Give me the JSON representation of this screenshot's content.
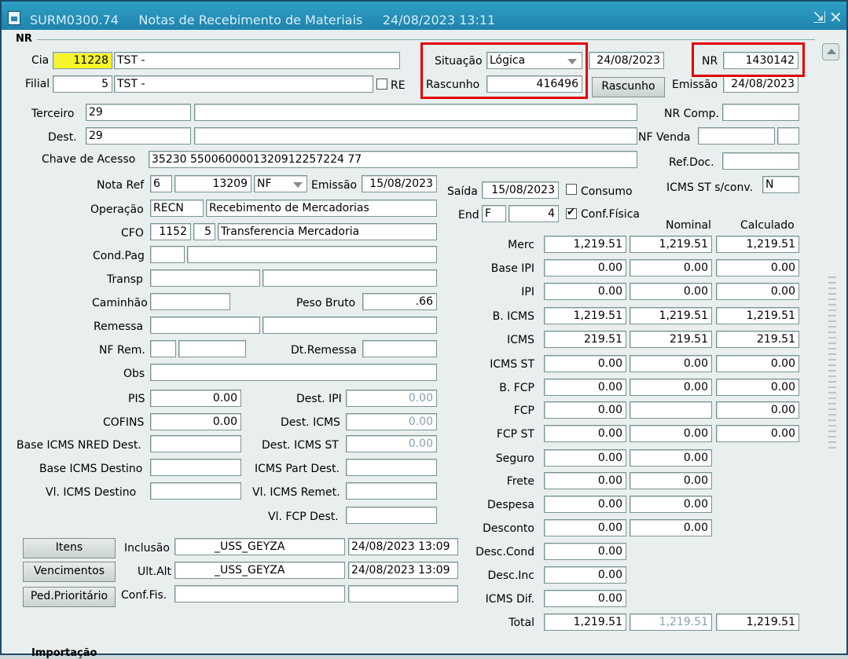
{
  "window": {
    "code": "SURM0300.74",
    "title": "Notas de Recebimento de Materiais",
    "datetime": "24/08/2023 13:11"
  },
  "section": {
    "nr_label": "NR",
    "importacao_label": "Importação"
  },
  "header": {
    "cia_label": "Cia",
    "cia_code": "11228",
    "cia_name": "TST -",
    "filial_label": "Filial",
    "filial_code": "5",
    "filial_name": "TST -",
    "re_label": "RE",
    "situacao_label": "Situação",
    "situacao_value": "Lógica",
    "situacao_date": "24/08/2023",
    "rascunho_label": "Rascunho",
    "rascunho_value": "416496",
    "rascunho_button": "Rascunho",
    "nr_label": "NR",
    "nr_value": "1430142",
    "emissao_label": "Emissão",
    "emissao_value": "24/08/2023"
  },
  "party": {
    "terceiro_label": "Terceiro",
    "terceiro_code": "29",
    "terceiro_name": "",
    "dest_label": "Dest.",
    "dest_code": "29",
    "dest_name": "",
    "chave_label": "Chave de Acesso",
    "chave_value": "35230 5500600001320912257224 77",
    "nrcomp_label": "NR Comp.",
    "nfvenda_label": "NF Venda",
    "refdoc_label": "Ref.Doc."
  },
  "nota": {
    "notaref_label": "Nota Ref",
    "notaref_serie": "6",
    "notaref_num": "13209",
    "notaref_tipo": "NF",
    "emissao_label": "Emissão",
    "emissao_value": "15/08/2023",
    "saida_label": "Saída",
    "saida_value": "15/08/2023",
    "consumo_label": "Consumo",
    "icmsst_label": "ICMS ST s/conv.",
    "icmsst_value": "N",
    "operacao_label": "Operação",
    "operacao_code": "RECN",
    "operacao_desc": "Recebimento de Mercadorias",
    "end_label": "End",
    "end_code": "F",
    "end_num": "4",
    "conffisica_label": "Conf.Física",
    "cfo_label": "CFO",
    "cfo_code": "1152",
    "cfo_sub": "5",
    "cfo_desc": "Transferencia Mercadoria",
    "condpag_label": "Cond.Pag",
    "transp_label": "Transp",
    "caminhao_label": "Caminhão",
    "pesobruto_label": "Peso Bruto",
    "pesobruto_value": ".66",
    "remessa_label": "Remessa",
    "nfrem_label": "NF Rem.",
    "dtremessa_label": "Dt.Remessa",
    "obs_label": "Obs"
  },
  "taxes": {
    "pis_label": "PIS",
    "pis_value": "0.00",
    "cofins_label": "COFINS",
    "cofins_value": "0.00",
    "baseicmsnred_label": "Base ICMS NRED Dest.",
    "baseicmsdest_label": "Base ICMS Destino",
    "vlicmsdest_label": "Vl. ICMS Destino",
    "destipi_label": "Dest. IPI",
    "destipi_value": "0.00",
    "desticms_label": "Dest. ICMS",
    "desticms_value": "0.00",
    "desticmsst_label": "Dest. ICMS ST",
    "desticmsst_value": "0.00",
    "icmspart_label": "ICMS Part Dest.",
    "vlicmsremet_label": "Vl. ICMS Remet.",
    "vlfcp_label": "Vl. FCP Dest."
  },
  "totals_headers": {
    "nominal": "Nominal",
    "calculado": "Calculado"
  },
  "totals": [
    {
      "label": "Merc",
      "v1": "1,219.51",
      "v2": "1,219.51",
      "v3": "1,219.51"
    },
    {
      "label": "Base IPI",
      "v1": "0.00",
      "v2": "0.00",
      "v3": "0.00"
    },
    {
      "label": "IPI",
      "v1": "0.00",
      "v2": "0.00",
      "v3": "0.00"
    },
    {
      "label": "B. ICMS",
      "v1": "1,219.51",
      "v2": "1,219.51",
      "v3": "1,219.51"
    },
    {
      "label": "ICMS",
      "v1": "219.51",
      "v2": "219.51",
      "v3": "219.51"
    },
    {
      "label": "ICMS ST",
      "v1": "0.00",
      "v2": "0.00",
      "v3": "0.00"
    },
    {
      "label": "B. FCP",
      "v1": "0.00",
      "v2": "0.00",
      "v3": "0.00"
    },
    {
      "label": "FCP",
      "v1": "0.00",
      "v2": "",
      "v3": "0.00"
    },
    {
      "label": "FCP ST",
      "v1": "0.00",
      "v2": "0.00",
      "v3": "0.00"
    },
    {
      "label": "Seguro",
      "v1": "0.00",
      "v2": "0.00"
    },
    {
      "label": "Frete",
      "v1": "0.00",
      "v2": "0.00"
    },
    {
      "label": "Despesa",
      "v1": "0.00",
      "v2": "0.00"
    },
    {
      "label": "Desconto",
      "v1": "0.00",
      "v2": "0.00"
    },
    {
      "label": "Desc.Cond",
      "v1": "0.00"
    },
    {
      "label": "Desc.Inc",
      "v1": "0.00"
    },
    {
      "label": "ICMS Dif.",
      "v1": "0.00"
    },
    {
      "label": "Total",
      "v1": "1,219.51",
      "v2": "1,219.51",
      "v3": "1,219.51"
    }
  ],
  "footer": {
    "itens_button": "Itens",
    "vencimentos_button": "Vencimentos",
    "pedprior_button": "Ped.Prioritário",
    "inclusao_label": "Inclusão",
    "inclusao_user": "_USS_GEYZA",
    "inclusao_date": "24/08/2023 13:09",
    "ultalt_label": "Ult.Alt",
    "ultalt_user": "_USS_GEYZA",
    "ultalt_date": "24/08/2023 13:09",
    "conffis_label": "Conf.Fis."
  }
}
